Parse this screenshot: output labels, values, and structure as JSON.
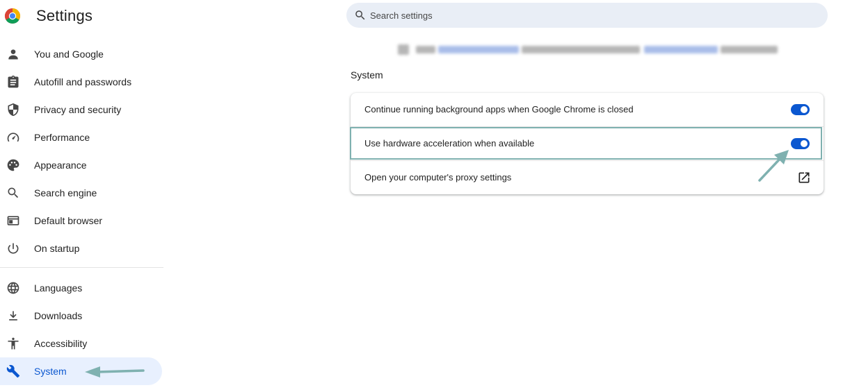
{
  "app": {
    "title": "Settings"
  },
  "sidebar": {
    "items": [
      {
        "label": "You and Google",
        "icon": "person-icon"
      },
      {
        "label": "Autofill and passwords",
        "icon": "clipboard-icon"
      },
      {
        "label": "Privacy and security",
        "icon": "shield-icon"
      },
      {
        "label": "Performance",
        "icon": "speedometer-icon"
      },
      {
        "label": "Appearance",
        "icon": "palette-icon"
      },
      {
        "label": "Search engine",
        "icon": "search-icon"
      },
      {
        "label": "Default browser",
        "icon": "browser-window-icon"
      },
      {
        "label": "On startup",
        "icon": "power-icon"
      },
      {
        "label": "Languages",
        "icon": "globe-icon"
      },
      {
        "label": "Downloads",
        "icon": "download-icon"
      },
      {
        "label": "Accessibility",
        "icon": "accessibility-icon"
      },
      {
        "label": "System",
        "icon": "wrench-icon",
        "active": true
      }
    ]
  },
  "search": {
    "placeholder": "Search settings"
  },
  "section": {
    "title": "System"
  },
  "settings": [
    {
      "label": "Continue running background apps when Google Chrome is closed",
      "control": "toggle",
      "enabled": true
    },
    {
      "label": "Use hardware acceleration when available",
      "control": "toggle",
      "enabled": true,
      "highlighted": true
    },
    {
      "label": "Open your computer's proxy settings",
      "control": "external-link"
    }
  ],
  "colors": {
    "accent": "#0b57d0",
    "active_bg": "#e8f0fe",
    "search_bg": "#e9eef6",
    "annotation": "#7fb1b0"
  }
}
